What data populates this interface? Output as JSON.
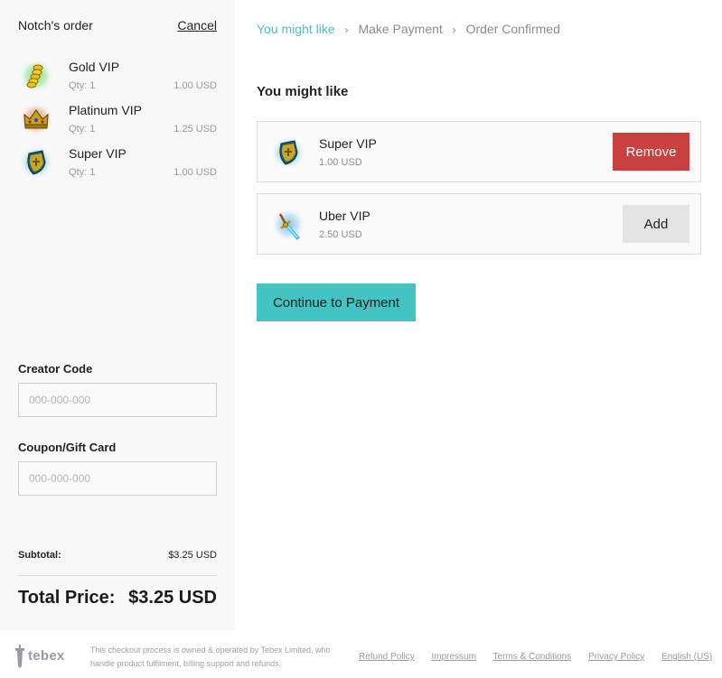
{
  "order": {
    "title": "Notch's order",
    "cancel_label": "Cancel",
    "items": [
      {
        "name": "Gold VIP",
        "qty": "Qty: 1",
        "price": "1.00 USD",
        "icon": "gold-coins-icon"
      },
      {
        "name": "Platinum VIP",
        "qty": "Qty: 1",
        "price": "1.25 USD",
        "icon": "crown-icon"
      },
      {
        "name": "Super VIP",
        "qty": "Qty: 1",
        "price": "1.00 USD",
        "icon": "shield-icon"
      }
    ]
  },
  "creator_code": {
    "label": "Creator Code",
    "placeholder": "000-000-000",
    "value": ""
  },
  "coupon": {
    "label": "Coupon/Gift Card",
    "placeholder": "000-000-000",
    "value": ""
  },
  "totals": {
    "subtotal_label": "Subtotal:",
    "subtotal_value": "$3.25 USD",
    "total_label": "Total Price:",
    "total_value": "$3.25 USD"
  },
  "breadcrumb": [
    {
      "label": "You might like",
      "active": true
    },
    {
      "label": "Make Payment",
      "active": false
    },
    {
      "label": "Order Confirmed",
      "active": false
    }
  ],
  "breadcrumb_separator": "›",
  "main": {
    "section_title": "You might like",
    "upsells": [
      {
        "name": "Super VIP",
        "price": "1.00 USD",
        "action": "Remove",
        "icon": "shield-icon"
      },
      {
        "name": "Uber VIP",
        "price": "2.50 USD",
        "action": "Add",
        "icon": "diamond-sword-icon"
      }
    ],
    "continue_label": "Continue to Payment"
  },
  "footer": {
    "brand": "tebex",
    "notice": "This checkout process is owned & operated by Tebex Limited, who handle product fulfilment, billing support and refunds.",
    "links": [
      "Refund Policy",
      "Impressum",
      "Terms & Conditions",
      "Privacy Policy",
      "English (US)"
    ]
  },
  "colors": {
    "accent": "#44c3c3",
    "breadcrumb_active": "#48bfbf",
    "remove": "#c94040",
    "add": "#e4e4e4",
    "sidebar_bg": "#f8f8f8"
  }
}
